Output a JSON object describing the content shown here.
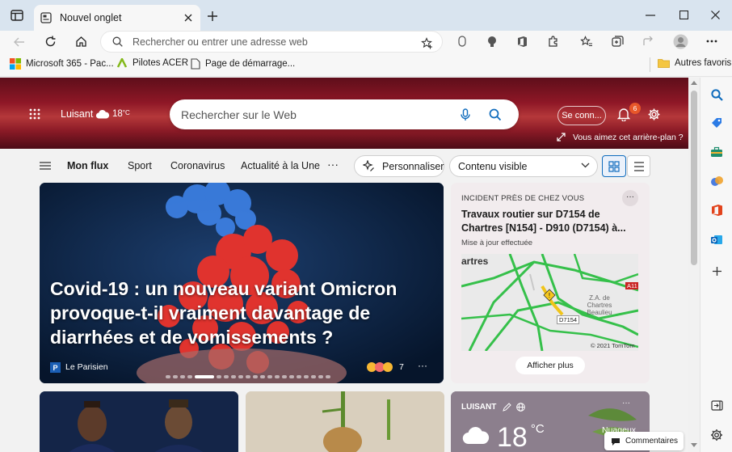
{
  "tab": {
    "title": "Nouvel onglet"
  },
  "address": {
    "placeholder": "Rechercher ou entrer une adresse web"
  },
  "favorites": {
    "items": [
      "Microsoft 365 - Pac...",
      "Pilotes ACER",
      "Page de démarrage..."
    ],
    "other": "Autres favoris"
  },
  "hero": {
    "location": "Luisant",
    "temp": "18",
    "unit": "°C",
    "search_placeholder": "Rechercher sur le Web",
    "signin": "Se conn...",
    "notif_count": "6",
    "bg_question": "Vous aimez cet arrière-plan ?"
  },
  "feed_nav": {
    "items": [
      "Mon flux",
      "Sport",
      "Coronavirus",
      "Actualité à la Une"
    ],
    "more": "···",
    "personalize": "Personnaliser",
    "visibility": "Contenu visible"
  },
  "main_article": {
    "headline": "Covid-19 : un nouveau variant Omicron provoque-t-il vraiment davantage de diarrhées et de vomissements ?",
    "source": "Le Parisien",
    "reactions": "7",
    "more": "···"
  },
  "incident": {
    "label": "INCIDENT PRÈS DE CHEZ VOUS",
    "title": "Travaux routier sur D7154 de Chartres [N154] - D910 (D7154) à...",
    "update": "Mise à jour effectuée",
    "map_city": "artres",
    "map_zone": "Z.A. de Chartres Beaulieu",
    "road": "D7154",
    "road2": "A11",
    "copyright": "© 2021 TomTom",
    "show_more": "Afficher plus",
    "more": "···"
  },
  "weather_card": {
    "location": "LUISANT",
    "temp": "18",
    "unit": "°C",
    "condition": "Nuageux",
    "more": "···"
  },
  "feedback": "Commentaires",
  "colors": {
    "accent": "#0f6cbd",
    "hero_bg": "#8e1726",
    "titlebar": "#d9e4ef"
  }
}
